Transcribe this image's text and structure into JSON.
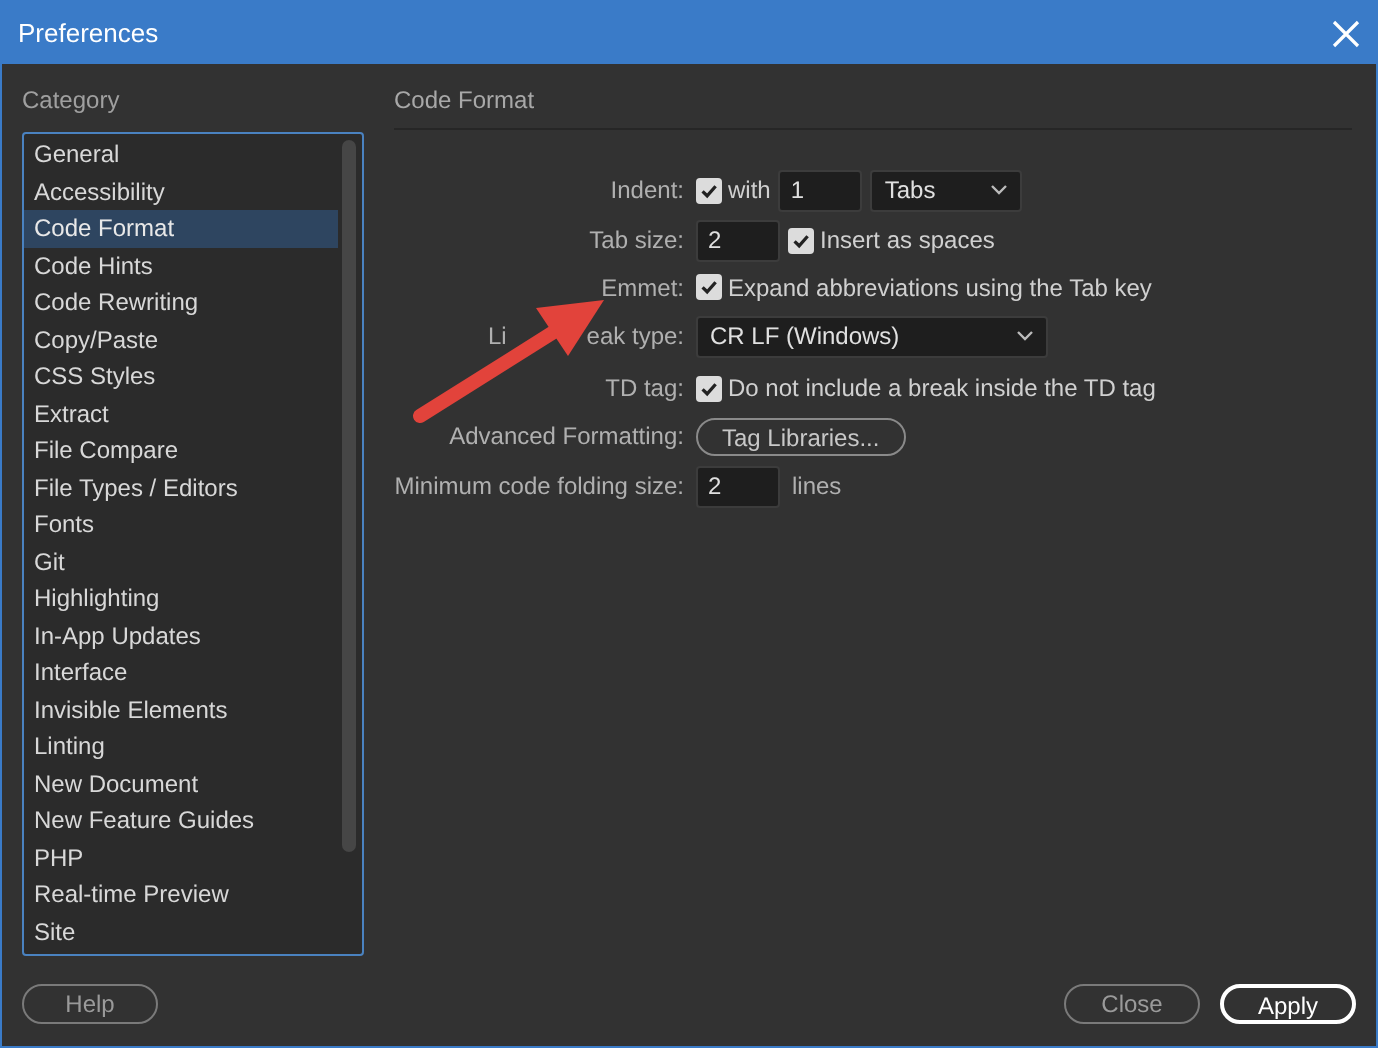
{
  "window": {
    "title": "Preferences"
  },
  "sidebar": {
    "heading": "Category",
    "items": [
      {
        "label": "General",
        "selected": false
      },
      {
        "label": "Accessibility",
        "selected": false
      },
      {
        "label": "Code Format",
        "selected": true
      },
      {
        "label": "Code Hints",
        "selected": false
      },
      {
        "label": "Code Rewriting",
        "selected": false
      },
      {
        "label": "Copy/Paste",
        "selected": false
      },
      {
        "label": "CSS Styles",
        "selected": false
      },
      {
        "label": "Extract",
        "selected": false
      },
      {
        "label": "File Compare",
        "selected": false
      },
      {
        "label": "File Types / Editors",
        "selected": false
      },
      {
        "label": "Fonts",
        "selected": false
      },
      {
        "label": "Git",
        "selected": false
      },
      {
        "label": "Highlighting",
        "selected": false
      },
      {
        "label": "In-App Updates",
        "selected": false
      },
      {
        "label": "Interface",
        "selected": false
      },
      {
        "label": "Invisible Elements",
        "selected": false
      },
      {
        "label": "Linting",
        "selected": false
      },
      {
        "label": "New Document",
        "selected": false
      },
      {
        "label": "New Feature Guides",
        "selected": false
      },
      {
        "label": "PHP",
        "selected": false
      },
      {
        "label": "Real-time Preview",
        "selected": false
      },
      {
        "label": "Site",
        "selected": false
      }
    ]
  },
  "panel": {
    "title": "Code Format",
    "rows": [
      {
        "label": "Indent:",
        "controls": [
          {
            "kind": "checkbox",
            "checked": true,
            "label": "with"
          },
          {
            "kind": "input",
            "value": "1"
          },
          {
            "kind": "select",
            "value": "Tabs"
          }
        ]
      },
      {
        "label": "Tab size:",
        "controls": [
          {
            "kind": "input",
            "value": "2"
          },
          {
            "kind": "checkbox",
            "checked": true,
            "label": "Insert as spaces"
          }
        ]
      },
      {
        "label": "Emmet:",
        "controls": [
          {
            "kind": "checkbox",
            "checked": true,
            "label": "Expand abbreviations using the Tab key"
          }
        ]
      },
      {
        "label_parts": [
          "Li",
          "eak type:"
        ],
        "controls": [
          {
            "kind": "select",
            "value": "CR LF (Windows)"
          }
        ]
      },
      {
        "label": "TD tag:",
        "controls": [
          {
            "kind": "checkbox",
            "checked": true,
            "label": "Do not include a break inside the TD tag"
          }
        ]
      },
      {
        "label": "Advanced Formatting:",
        "controls": [
          {
            "kind": "button",
            "label": "Tag Libraries..."
          }
        ]
      },
      {
        "label": "Minimum code folding size:",
        "controls": [
          {
            "kind": "input",
            "value": "2"
          },
          {
            "kind": "text",
            "text": "lines"
          }
        ]
      }
    ]
  },
  "annotation": {
    "kind": "arrow"
  },
  "buttons": [
    {
      "label": "Help",
      "kind": "secondary"
    },
    {
      "label": "Close",
      "kind": "secondary"
    },
    {
      "label": "Apply",
      "kind": "primary"
    }
  ]
}
